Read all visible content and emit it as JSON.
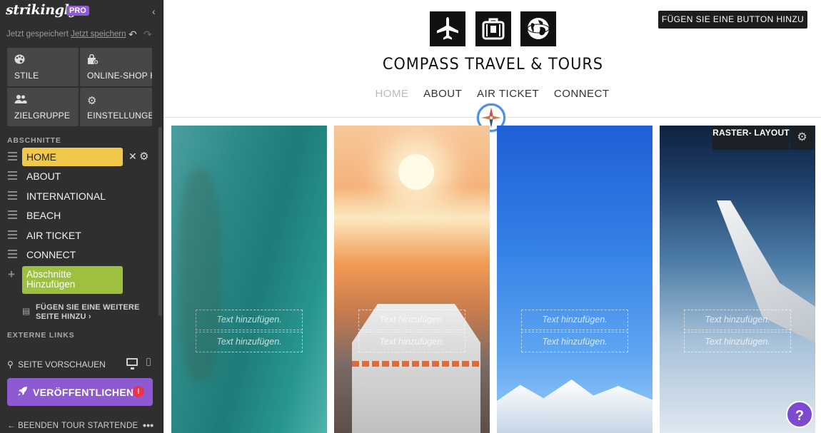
{
  "app": {
    "logo": "strikingly",
    "badge": "PRO",
    "save_status": "Jetzt gespeichert",
    "save_now": "Jetzt speichern"
  },
  "tiles": {
    "styles": "STILE",
    "shop": "ONLINE-SHOP HINZUFÜGEN",
    "audience": "ZIELGRUPPE",
    "settings": "EINSTELLUNGEN"
  },
  "sections": {
    "heading": "ABSCHNITTE",
    "items": [
      "HOME",
      "ABOUT",
      "INTERNATIONAL",
      "BEACH",
      "AIR TICKET",
      "CONNECT"
    ],
    "selected": "HOME",
    "add_section": "Abschnitte Hinzufügen",
    "add_page": "FÜGEN SIE EINE WEITERE SEITE HINZU ›"
  },
  "external_links": {
    "heading": "EXTERNE LINKS"
  },
  "preview": {
    "label": "SEITE VORSCHAUEN"
  },
  "publish": {
    "label": "VERÖFFENTLICHEN",
    "alert": "!"
  },
  "footer": {
    "exit": "BEENDEN",
    "tour": "TOUR STARTEN",
    "lang": "DE",
    "more": "•••"
  },
  "site": {
    "title": "COMPASS TRAVEL & TOURS",
    "add_button": "FÜGEN SIE EINE BUTTON HINZU",
    "header_icons": [
      "plane-icon",
      "luggage-icon",
      "globe-icon"
    ],
    "nav": [
      "HOME",
      "ABOUT",
      "AIR TICKET",
      "CONNECT"
    ],
    "nav_active": "HOME"
  },
  "grid": {
    "layout_button": "RASTER- LAYOUT",
    "placeholder": "Text hinzufügen.",
    "columns": [
      "ocean",
      "cruise-ship",
      "sky-mountains",
      "airplane-wing"
    ]
  },
  "help": {
    "label": "?"
  },
  "colors": {
    "sidebar_bg": "#2f2f2f",
    "selected_section": "#f0c84a",
    "add_section": "#9dc03f",
    "publish": "#8e5ad1",
    "alert": "#e8344a"
  }
}
